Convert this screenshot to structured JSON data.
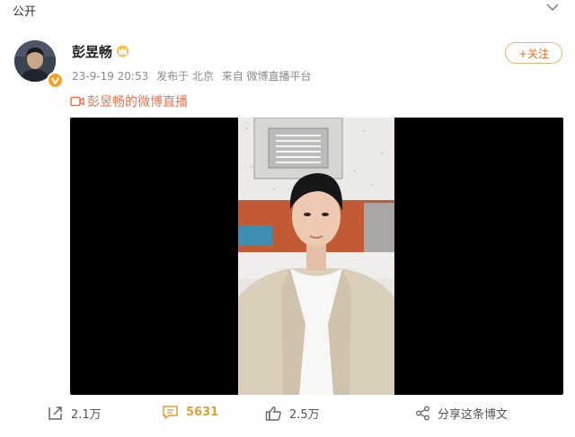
{
  "header": {
    "visibility": "公开"
  },
  "post": {
    "author": "彭昱畅",
    "time": "23-9-19 20:53",
    "location": "发布于 北京",
    "source": "来自 微博直播平台",
    "follow_label": "+关注",
    "live_link": "彭昱畅的微博直播"
  },
  "actions": {
    "repost": "2.1万",
    "comment": "5631",
    "like": "2.5万",
    "share": "分享这条博文"
  },
  "colors": {
    "accent": "#eb7350",
    "follow_border": "#e9b47a",
    "comment_count": "#d8a23a",
    "video_bg": "#000000",
    "verified": "#f0a330"
  },
  "icons": [
    "chevron-down-icon",
    "crown-icon",
    "verified-icon",
    "live-video-icon",
    "repost-icon",
    "comment-icon",
    "like-icon",
    "share-icon"
  ]
}
